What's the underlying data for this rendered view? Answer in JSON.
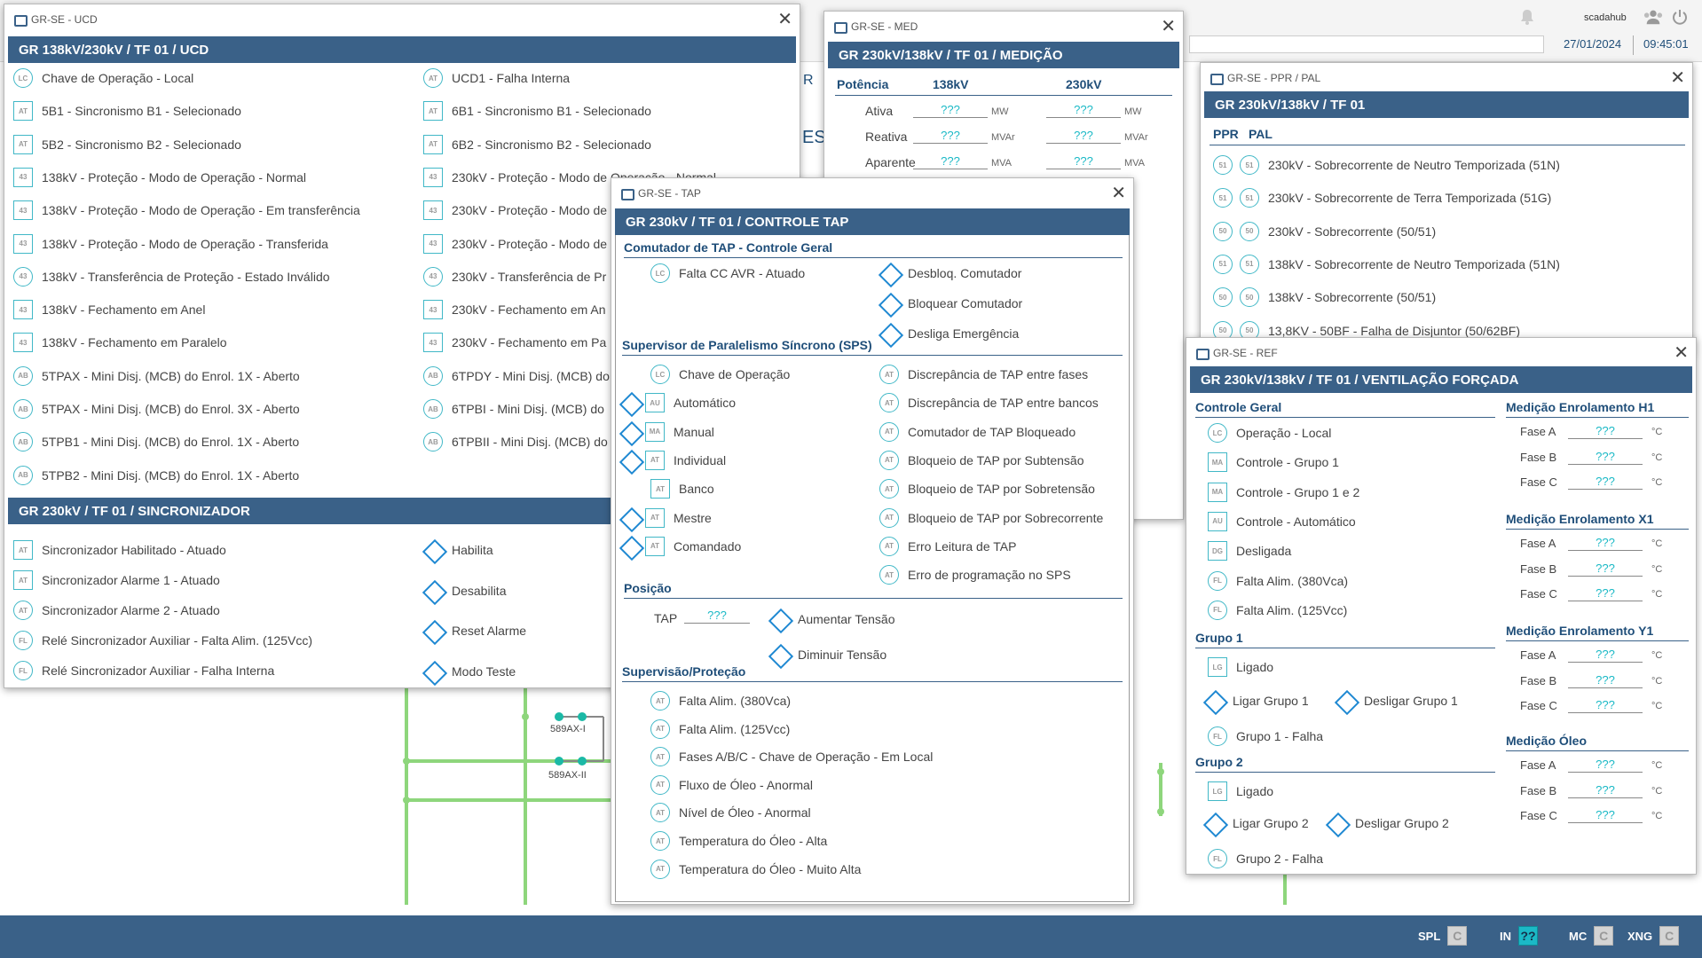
{
  "topbar": {
    "user": "scadahub",
    "date": "27/01/2024",
    "time": "09:45:01"
  },
  "footer": {
    "items": [
      {
        "label": "SPL",
        "value": "C"
      },
      {
        "label": "IN",
        "value": "??"
      },
      {
        "label": "MC",
        "value": "C"
      },
      {
        "label": "XNG",
        "value": "C"
      }
    ]
  },
  "background": {
    "labels": {
      "b1": "589AX-I",
      "b2": "589AX-II",
      "r": "R",
      "es": "ES"
    }
  },
  "ucd": {
    "window_title": "GR-SE - UCD",
    "header": "GR 138kV/230kV / TF 01 / UCD",
    "left": [
      {
        "badge": "LC",
        "text": "Chave de Operação - Local",
        "shape": "ci"
      },
      {
        "badge": "AT",
        "text": "5B1 - Sincronismo B1 - Selecionado",
        "shape": "sq"
      },
      {
        "badge": "AT",
        "text": "5B2 - Sincronismo B2 - Selecionado",
        "shape": "sq"
      },
      {
        "badge": "43",
        "text": "138kV - Proteção - Modo de Operação - Normal",
        "shape": "sq"
      },
      {
        "badge": "43",
        "text": "138kV - Proteção - Modo de Operação - Em transferência",
        "shape": "sq"
      },
      {
        "badge": "43",
        "text": "138kV - Proteção - Modo de Operação - Transferida",
        "shape": "sq"
      },
      {
        "badge": "43",
        "text": "138kV - Transferência de Proteção - Estado Inválido",
        "shape": "ci"
      },
      {
        "badge": "43",
        "text": "138kV - Fechamento em Anel",
        "shape": "sq"
      },
      {
        "badge": "43",
        "text": "138kV - Fechamento em Paralelo",
        "shape": "sq"
      },
      {
        "badge": "AB",
        "text": "5TPAX - Mini Disj. (MCB) do Enrol. 1X - Aberto",
        "shape": "ci"
      },
      {
        "badge": "AB",
        "text": "5TPAX - Mini Disj. (MCB) do Enrol. 3X - Aberto",
        "shape": "ci"
      },
      {
        "badge": "AB",
        "text": "5TPB1 - Mini Disj. (MCB) do Enrol. 1X - Aberto",
        "shape": "ci"
      },
      {
        "badge": "AB",
        "text": "5TPB2 - Mini Disj. (MCB) do Enrol. 1X - Aberto",
        "shape": "ci"
      }
    ],
    "right": [
      {
        "badge": "AT",
        "text": "UCD1 - Falha Interna",
        "shape": "ci"
      },
      {
        "badge": "AT",
        "text": "6B1 - Sincronismo B1 - Selecionado",
        "shape": "sq"
      },
      {
        "badge": "AT",
        "text": "6B2 - Sincronismo B2 - Selecionado",
        "shape": "sq"
      },
      {
        "badge": "43",
        "text": "230kV - Proteção - Modo de Operação - Normal",
        "shape": "sq"
      },
      {
        "badge": "43",
        "text": "230kV - Proteção - Modo de",
        "shape": "sq"
      },
      {
        "badge": "43",
        "text": "230kV - Proteção - Modo de",
        "shape": "sq"
      },
      {
        "badge": "43",
        "text": "230kV - Transferência de Pr",
        "shape": "ci"
      },
      {
        "badge": "43",
        "text": "230kV - Fechamento em An",
        "shape": "sq"
      },
      {
        "badge": "43",
        "text": "230kV - Fechamento em Pa",
        "shape": "sq"
      },
      {
        "badge": "AB",
        "text": "6TPDY - Mini Disj. (MCB) do",
        "shape": "ci"
      },
      {
        "badge": "AB",
        "text": "6TPBI - Mini Disj. (MCB) do",
        "shape": "ci"
      },
      {
        "badge": "AB",
        "text": "6TPBII - Mini Disj. (MCB) do",
        "shape": "ci"
      }
    ],
    "sync_header": "GR 230kV / TF 01 / SINCRONIZADOR",
    "sync_left": [
      {
        "badge": "AT",
        "text": "Sincronizador Habilitado - Atuado",
        "shape": "sq"
      },
      {
        "badge": "AT",
        "text": "Sincronizador Alarme 1 - Atuado",
        "shape": "sq"
      },
      {
        "badge": "AT",
        "text": "Sincronizador Alarme 2 - Atuado",
        "shape": "ci"
      },
      {
        "badge": "FL",
        "text": "Relé Sincronizador Auxiliar - Falta Alim. (125Vcc)",
        "shape": "ci"
      },
      {
        "badge": "FL",
        "text": "Relé Sincronizador Auxiliar - Falha Interna",
        "shape": "ci"
      }
    ],
    "sync_right": [
      "Habilita",
      "Desabilita",
      "Reset Alarme",
      "Modo Teste"
    ]
  },
  "med": {
    "window_title": "GR-SE - MED",
    "header": "GR 230kV/138kV / TF 01 / MEDIÇÃO",
    "cols": [
      "Potência",
      "138kV",
      "230kV"
    ],
    "rows": [
      {
        "label": "Ativa",
        "v1": "???",
        "u1": "MW",
        "v2": "???",
        "u2": "MW"
      },
      {
        "label": "Reativa",
        "v1": "???",
        "u1": "MVAr",
        "v2": "???",
        "u2": "MVAr"
      },
      {
        "label": "Aparente",
        "v1": "???",
        "u1": "MVA",
        "v2": "???",
        "u2": "MVA"
      }
    ]
  },
  "ppr": {
    "window_title": "GR-SE - PPR / PAL",
    "header": "GR 230kV/138kV / TF 01",
    "cols": [
      "PPR",
      "PAL"
    ],
    "rows": [
      {
        "b": "51",
        "text": "230kV - Sobrecorrente de Neutro Temporizada (51N)"
      },
      {
        "b": "51",
        "text": "230kV - Sobrecorrente de Terra Temporizada (51G)"
      },
      {
        "b": "50",
        "text": "230kV - Sobrecorrente (50/51)"
      },
      {
        "b": "51",
        "text": "138kV - Sobrecorrente de Neutro Temporizada (51N)"
      },
      {
        "b": "50",
        "text": "138kV - Sobrecorrente (50/51)"
      },
      {
        "b": "50",
        "text": "13,8KV - 50BF - Falha de Disjuntor (50/62BF)"
      }
    ]
  },
  "tap": {
    "window_title": "GR-SE - TAP",
    "header": "GR 230kV / TF 01 / CONTROLE TAP",
    "s1": "Comutador de TAP - Controle Geral",
    "s1_left": {
      "badge": "LC",
      "text": "Falta CC AVR - Atuado"
    },
    "s1_right": [
      "Desbloq. Comutador",
      "Bloquear Comutador",
      "Desliga Emergência"
    ],
    "s2": "Supervisor de Paralelismo Síncrono (SPS)",
    "s2_left": [
      {
        "badge": "LC",
        "text": "Chave de Operação",
        "dia": false,
        "shape": "ci"
      },
      {
        "badge": "AU",
        "text": "Automático",
        "dia": true,
        "shape": "sq"
      },
      {
        "badge": "MA",
        "text": "Manual",
        "dia": true,
        "shape": "sq"
      },
      {
        "badge": "AT",
        "text": "Individual",
        "dia": true,
        "shape": "sq"
      },
      {
        "badge": "AT",
        "text": "Banco",
        "dia": false,
        "shape": "sq"
      },
      {
        "badge": "AT",
        "text": "Mestre",
        "dia": true,
        "shape": "sq"
      },
      {
        "badge": "AT",
        "text": "Comandado",
        "dia": true,
        "shape": "sq"
      }
    ],
    "s2_right": [
      "Discrepância de TAP entre fases",
      "Discrepância de TAP entre bancos",
      "Comutador de TAP Bloqueado",
      "Bloqueio de TAP por Subtensão",
      "Bloqueio de TAP por Sobretensão",
      "Bloqueio de TAP por Sobrecorrente",
      "Erro Leitura de TAP",
      "Erro de programação no SPS"
    ],
    "s3": "Posição",
    "tap_label": "TAP",
    "tap_value": "???",
    "raise": "Aumentar Tensão",
    "lower": "Diminuir Tensão",
    "s4": "Supervisão/Proteção",
    "s4_items": [
      "Falta Alim. (380Vca)",
      "Falta Alim. (125Vcc)",
      "Fases A/B/C - Chave de Operação - Em Local",
      "Fluxo de Óleo - Anormal",
      "Nível de Óleo - Anormal",
      "Temperatura do Óleo - Alta",
      "Temperatura do Óleo - Muito Alta"
    ]
  },
  "ref": {
    "window_title": "GR-SE - REF",
    "header": "GR 230kV/138kV / TF 01 / VENTILAÇÃO FORÇADA",
    "s1": "Controle Geral",
    "s1_items": [
      {
        "badge": "LC",
        "text": "Operação - Local",
        "shape": "ci"
      },
      {
        "badge": "MA",
        "text": "Controle - Grupo 1",
        "shape": "sq"
      },
      {
        "badge": "MA",
        "text": "Controle - Grupo 1 e 2",
        "shape": "sq"
      },
      {
        "badge": "AU",
        "text": "Controle - Automático",
        "shape": "sq"
      },
      {
        "badge": "DG",
        "text": "Desligada",
        "shape": "sq"
      },
      {
        "badge": "FL",
        "text": "Falta Alim. (380Vca)",
        "shape": "ci"
      },
      {
        "badge": "FL",
        "text": "Falta Alim. (125Vcc)",
        "shape": "ci"
      }
    ],
    "g1": "Grupo 1",
    "g1_on": {
      "badge": "LG",
      "text": "Ligado"
    },
    "g1_btn_on": "Ligar Grupo 1",
    "g1_btn_off": "Desligar Grupo 1",
    "g1_fail": {
      "badge": "FL",
      "text": "Grupo 1 - Falha"
    },
    "g2": "Grupo 2",
    "g2_on": {
      "badge": "LG",
      "text": "Ligado"
    },
    "g2_btn_on": "Ligar Grupo 2",
    "g2_btn_off": "Desligar Grupo 2",
    "g2_fail": {
      "badge": "FL",
      "text": "Grupo 2 - Falha"
    },
    "meas": [
      {
        "title": "Medição Enrolamento H1",
        "rows": [
          {
            "l": "Fase A",
            "v": "???",
            "u": "°C"
          },
          {
            "l": "Fase B",
            "v": "???",
            "u": "°C"
          },
          {
            "l": "Fase C",
            "v": "???",
            "u": "°C"
          }
        ]
      },
      {
        "title": "Medição Enrolamento X1",
        "rows": [
          {
            "l": "Fase A",
            "v": "???",
            "u": "°C"
          },
          {
            "l": "Fase B",
            "v": "???",
            "u": "°C"
          },
          {
            "l": "Fase C",
            "v": "???",
            "u": "°C"
          }
        ]
      },
      {
        "title": "Medição Enrolamento Y1",
        "rows": [
          {
            "l": "Fase A",
            "v": "???",
            "u": "°C"
          },
          {
            "l": "Fase B",
            "v": "???",
            "u": "°C"
          },
          {
            "l": "Fase C",
            "v": "???",
            "u": "°C"
          }
        ]
      },
      {
        "title": "Medição Óleo",
        "rows": [
          {
            "l": "Fase A",
            "v": "???",
            "u": "°C"
          },
          {
            "l": "Fase B",
            "v": "???",
            "u": "°C"
          },
          {
            "l": "Fase C",
            "v": "???",
            "u": "°C"
          }
        ]
      }
    ]
  }
}
